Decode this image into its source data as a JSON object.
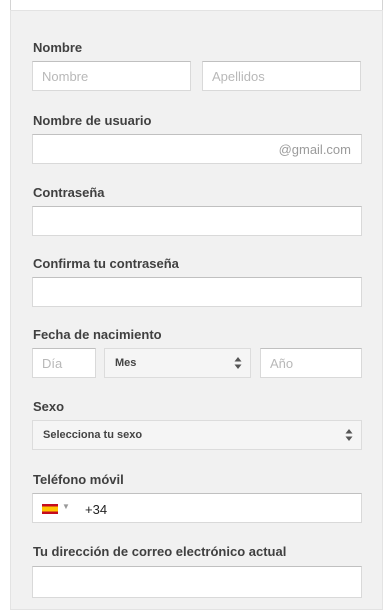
{
  "form": {
    "name": {
      "label": "Nombre",
      "first_placeholder": "Nombre",
      "last_placeholder": "Apellidos"
    },
    "username": {
      "label": "Nombre de usuario",
      "suffix": "@gmail.com"
    },
    "password": {
      "label": "Contraseña"
    },
    "confirm_password": {
      "label": "Confirma tu contraseña"
    },
    "birthdate": {
      "label": "Fecha de nacimiento",
      "day_placeholder": "Día",
      "month_selected": "Mes",
      "year_placeholder": "Año"
    },
    "gender": {
      "label": "Sexo",
      "selected": "Selecciona tu sexo"
    },
    "phone": {
      "label": "Teléfono móvil",
      "country_code": "+34",
      "flag_icon": "spain-flag-icon"
    },
    "current_email": {
      "label": "Tu dirección de correo electrónico actual"
    }
  },
  "colors": {
    "panel_bg": "#f1f1f1",
    "label_text": "#404040",
    "placeholder": "#b8b8b8",
    "flag_red": "#c60b1e",
    "flag_yellow": "#ffc400"
  }
}
